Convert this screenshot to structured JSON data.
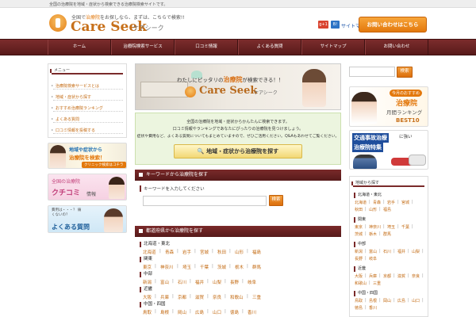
{
  "topbar": {
    "text": "全国の治療院を地域・症状から検索できる治療院検索サイトです。"
  },
  "header": {
    "tagline_pre": "全国で",
    "tagline_hl": "治療院",
    "tagline_post": "をお探しなら、まずは、こちらで検索!!",
    "logo": "Care Seek",
    "logo_sub": "ケアシーク",
    "gplus": "g+1",
    "hatena": "B!",
    "site_map": "サイトマップ",
    "contact_label": "お問い合わせはこちら"
  },
  "nav": {
    "items": [
      "ホーム",
      "治療院検索サービス",
      "口コミ情報",
      "よくある質問",
      "サイトマップ",
      "お問い合わせ"
    ]
  },
  "left": {
    "menu_title": "メニュー",
    "menu_items": [
      "治療院検索サービスとは",
      "地域・症状から探す",
      "おすすめ治療院ランキング",
      "よくある質問",
      "口コミ情報を投稿する"
    ],
    "banner1_line1": "地域や症状から",
    "banner1_line2": "治療院を検索！",
    "banner1_button": "クリニック検索はコチラ",
    "banner2_line1": "全国の治療院",
    "banner2_line2": "クチコミ",
    "banner2_line3": "情報",
    "banner3_note": "費用は・・・？ 痛くないの？",
    "banner3_title": "よくある質問"
  },
  "hero": {
    "catch_pre": "わたしにピッタリの",
    "catch_hl": "治療院",
    "catch_post": "が検索できる！！",
    "logo": "Care Seek",
    "logo_sub": "ケアシーク"
  },
  "intro": {
    "line1": "全国の治療院を地域・症状からかんたんに検索できます。",
    "line2": "口コミ情報やランキングであなたにぴったりの治療院を見つけましょう。",
    "line3": "症状や費用など、よくある質問についてもまとめていますので、ぜひご活用ください。Q&Aもあわせてご覧ください。",
    "search_button": "地域・症状から治療院を探す"
  },
  "keyword": {
    "section_title": "キーワードから治療院を探す",
    "label": "キーワードを入力してください",
    "placeholder": "",
    "button": "検索"
  },
  "region": {
    "section_title": "都道府県から治療院を探す",
    "groups": [
      {
        "name": "北海道・東北",
        "prefs": [
          "北海道",
          "青森",
          "岩手",
          "宮城",
          "秋田",
          "山形",
          "福島"
        ]
      },
      {
        "name": "関東",
        "prefs": [
          "東京",
          "神奈川",
          "埼玉",
          "千葉",
          "茨城",
          "栃木",
          "群馬"
        ]
      },
      {
        "name": "中部",
        "prefs": [
          "新潟",
          "富山",
          "石川",
          "福井",
          "山梨",
          "長野",
          "岐阜"
        ]
      },
      {
        "name": "近畿",
        "prefs": [
          "大阪",
          "兵庫",
          "京都",
          "滋賀",
          "奈良",
          "和歌山",
          "三重"
        ]
      },
      {
        "name": "中国・四国",
        "prefs": [
          "鳥取",
          "島根",
          "岡山",
          "広島",
          "山口",
          "徳島",
          "香川"
        ]
      }
    ]
  },
  "right": {
    "search_placeholder": "",
    "search_button": "検索",
    "ranking_line1": "今月のおすすめ",
    "ranking_line2": "治療院",
    "ranking_line3": "月間ランキング",
    "ranking_line4": "BEST10",
    "accident_line1": "交通事故治療",
    "accident_line2": "に強い",
    "accident_line3": "治療院特集",
    "region_title": "地域から探す",
    "groups": [
      {
        "name": "北海道・東北",
        "prefs": [
          "北海道",
          "青森",
          "岩手",
          "宮城",
          "秋田",
          "山形",
          "福島"
        ]
      },
      {
        "name": "関東",
        "prefs": [
          "東京",
          "神奈川",
          "埼玉",
          "千葉",
          "茨城",
          "栃木",
          "群馬"
        ]
      },
      {
        "name": "中部",
        "prefs": [
          "新潟",
          "富山",
          "石川",
          "福井",
          "山梨",
          "長野",
          "岐阜"
        ]
      },
      {
        "name": "近畿",
        "prefs": [
          "大阪",
          "兵庫",
          "京都",
          "滋賀",
          "奈良",
          "和歌山",
          "三重"
        ]
      },
      {
        "name": "中国・四国",
        "prefs": [
          "鳥取",
          "島根",
          "岡山",
          "広島",
          "山口",
          "徳島",
          "香川"
        ]
      }
    ]
  },
  "colors": {
    "brand": "#c7701a",
    "accent_orange": "#e3780c",
    "nav_maroon": "#6b2323",
    "link": "#c36a12",
    "intro_bg": "#ecf5df"
  }
}
